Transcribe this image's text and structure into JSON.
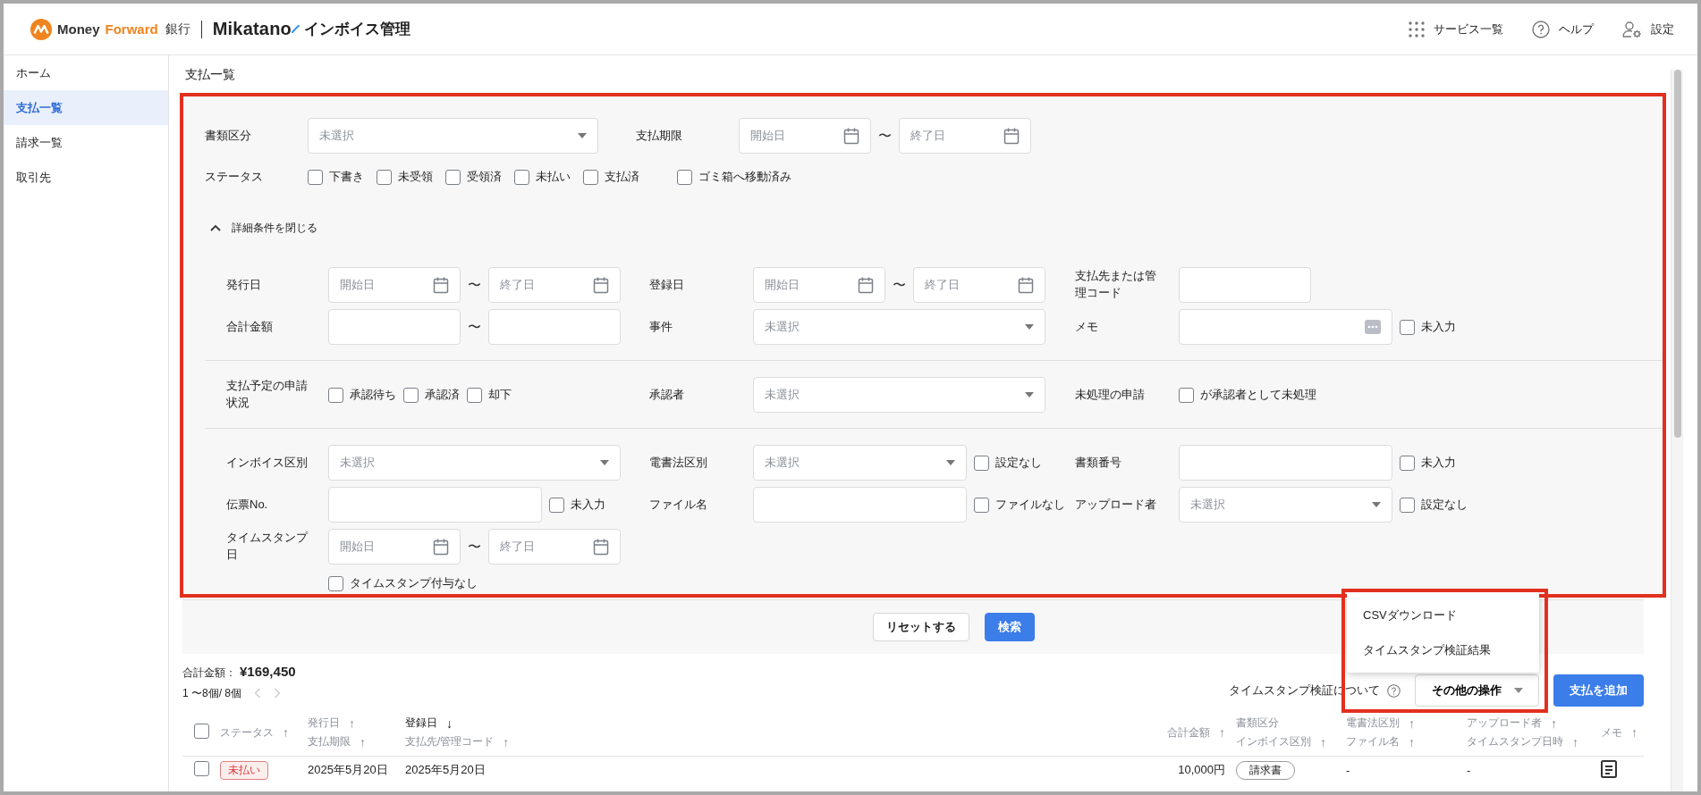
{
  "header": {
    "logo_word_1": "Money",
    "logo_word_2": "Forward",
    "logo_suffix": "銀行",
    "product_name": "Mikatano",
    "product_suffix": "インボイス管理",
    "links": [
      {
        "kind": "services",
        "label": "サービス一覧"
      },
      {
        "kind": "help",
        "label": "ヘルプ"
      },
      {
        "kind": "settings",
        "label": "設定"
      }
    ]
  },
  "sidebar": {
    "items": [
      {
        "label": "ホーム",
        "selected": false
      },
      {
        "label": "支払一覧",
        "selected": true
      },
      {
        "label": "請求一覧",
        "selected": false
      },
      {
        "label": "取引先",
        "selected": false
      }
    ]
  },
  "page_title": "支払一覧",
  "filters": {
    "basic": [
      {
        "fields": [
          {
            "label": "書類区分",
            "controls": [
              {
                "kind": "select",
                "placeholder": "未選択"
              }
            ]
          },
          {
            "label": "支払期限",
            "controls": [
              {
                "kind": "date",
                "placeholder": "開始日"
              },
              {
                "kind": "separator",
                "text": "〜"
              },
              {
                "kind": "date",
                "placeholder": "終了日"
              }
            ]
          }
        ]
      },
      {
        "fields": [
          {
            "label": "ステータス",
            "controls": [
              {
                "kind": "checkbox",
                "label": "下書き",
                "checked": false
              },
              {
                "kind": "checkbox",
                "label": "未受領",
                "checked": false
              },
              {
                "kind": "checkbox",
                "label": "受領済",
                "checked": false
              },
              {
                "kind": "checkbox",
                "label": "未払い",
                "checked": false
              },
              {
                "kind": "checkbox",
                "label": "支払済",
                "checked": false
              },
              {
                "kind": "checkbox",
                "label": "ゴミ箱へ移動済み",
                "checked": false
              }
            ]
          }
        ]
      }
    ],
    "toggle": {
      "label": "詳細条件を閉じる",
      "expanded": true
    },
    "groups": [
      [
        {
          "fields": [
            {
              "label": "発行日",
              "controls": [
                {
                  "kind": "date",
                  "placeholder": "開始日"
                },
                {
                  "kind": "separator",
                  "text": "〜"
                },
                {
                  "kind": "date",
                  "placeholder": "終了日"
                }
              ]
            },
            {
              "label": "登録日",
              "controls": [
                {
                  "kind": "date",
                  "placeholder": "開始日"
                },
                {
                  "kind": "separator",
                  "text": "〜"
                },
                {
                  "kind": "date",
                  "placeholder": "終了日"
                }
              ]
            },
            {
              "label": "支払先または管理コード",
              "controls": [
                {
                  "kind": "text"
                }
              ]
            }
          ]
        },
        {
          "fields": [
            {
              "label": "合計金額",
              "controls": [
                {
                  "kind": "text"
                },
                {
                  "kind": "separator",
                  "text": "〜"
                },
                {
                  "kind": "text"
                }
              ]
            },
            {
              "label": "事件",
              "controls": [
                {
                  "kind": "select",
                  "placeholder": "未選択"
                }
              ]
            },
            {
              "label": "メモ",
              "controls": [
                {
                  "kind": "memo"
                },
                {
                  "kind": "checkbox",
                  "label": "未入力",
                  "checked": false
                }
              ]
            }
          ]
        }
      ],
      [
        {
          "fields": [
            {
              "label": "支払予定の申請状況",
              "controls": [
                {
                  "kind": "checkbox",
                  "label": "承認待ち",
                  "checked": false
                },
                {
                  "kind": "checkbox",
                  "label": "承認済",
                  "checked": false
                },
                {
                  "kind": "checkbox",
                  "label": "却下",
                  "checked": false
                }
              ]
            },
            {
              "label": "承認者",
              "controls": [
                {
                  "kind": "select",
                  "placeholder": "未選択"
                }
              ]
            },
            {
              "label": "未処理の申請",
              "controls": [
                {
                  "kind": "checkbox",
                  "label": "が承認者として未処理",
                  "checked": false
                }
              ]
            }
          ]
        }
      ],
      [
        {
          "fields": [
            {
              "label": "インボイス区別",
              "controls": [
                {
                  "kind": "select",
                  "placeholder": "未選択"
                }
              ]
            },
            {
              "label": "電書法区別",
              "controls": [
                {
                  "kind": "select",
                  "placeholder": "未選択"
                },
                {
                  "kind": "checkbox",
                  "label": "設定なし",
                  "checked": false
                }
              ]
            },
            {
              "label": "書類番号",
              "controls": [
                {
                  "kind": "text"
                },
                {
                  "kind": "checkbox",
                  "label": "未入力",
                  "checked": false
                }
              ]
            }
          ]
        },
        {
          "fields": [
            {
              "label": "伝票No.",
              "controls": [
                {
                  "kind": "text"
                },
                {
                  "kind": "checkbox",
                  "label": "未入力",
                  "checked": false
                }
              ]
            },
            {
              "label": "ファイル名",
              "controls": [
                {
                  "kind": "text"
                },
                {
                  "kind": "checkbox",
                  "label": "ファイルなし",
                  "checked": false
                }
              ]
            },
            {
              "label": "アップロード者",
              "controls": [
                {
                  "kind": "select",
                  "placeholder": "未選択"
                },
                {
                  "kind": "checkbox",
                  "label": "設定なし",
                  "checked": false
                }
              ]
            }
          ]
        },
        {
          "fields": [
            {
              "label": "タイムスタンプ日",
              "controls": [
                {
                  "kind": "date",
                  "placeholder": "開始日"
                },
                {
                  "kind": "separator",
                  "text": "〜"
                },
                {
                  "kind": "date",
                  "placeholder": "終了日"
                }
              ]
            }
          ]
        },
        {
          "fields": [
            {
              "controls": [
                {
                  "kind": "checkbox",
                  "label": "タイムスタンプ付与なし",
                  "checked": false
                }
              ]
            }
          ]
        }
      ]
    ],
    "reset_button": "リセットする",
    "search_button": "検索"
  },
  "results": {
    "total_label": "合計金額：",
    "total_value": "¥169,450",
    "pagination": "1 〜8個/ 8個",
    "timestamp_help": "タイムスタンプ検証について",
    "other_actions": "その他の操作",
    "add_button": "支払を追加",
    "menu": {
      "items": [
        "CSVダウンロード",
        "タイムスタンプ検証結果"
      ]
    }
  },
  "table": {
    "select_all": {
      "checked": false
    },
    "columns": [
      {
        "kind": "text",
        "lines": [
          {
            "label": "ステータス",
            "arrow": "↑",
            "active": false
          }
        ]
      },
      {
        "kind": "text",
        "lines": [
          {
            "label": "発行日",
            "arrow": "↑",
            "active": false
          },
          {
            "label": "支払期限",
            "arrow": "↑",
            "active": false
          }
        ]
      },
      {
        "kind": "text",
        "lines": [
          {
            "label": "登録日",
            "arrow": "↓",
            "active": true
          },
          {
            "label": "支払先/管理コード",
            "arrow": "↑",
            "active": false
          }
        ]
      },
      {
        "kind": "number",
        "lines": [
          {
            "label": "合計金額",
            "arrow": "↑",
            "active": false
          }
        ]
      },
      {
        "kind": "text",
        "lines": [
          {
            "label": "書類区分",
            "active": false
          },
          {
            "label": "インボイス区別",
            "arrow": "↑",
            "active": false
          }
        ]
      },
      {
        "kind": "text",
        "lines": [
          {
            "label": "電書法区別",
            "arrow": "↑",
            "active": false
          },
          {
            "label": "ファイル名",
            "arrow": "↑",
            "active": false
          }
        ]
      },
      {
        "kind": "text",
        "lines": [
          {
            "label": "アップロード者",
            "arrow": "↑",
            "active": false
          },
          {
            "label": "タイムスタンプ日時",
            "arrow": "↑",
            "active": false
          }
        ]
      },
      {
        "kind": "text",
        "lines": [
          {
            "label": "メモ",
            "arrow": "↑",
            "active": false
          }
        ]
      }
    ],
    "rows": [
      {
        "selected": false,
        "cells": [
          {
            "kind": "badge",
            "text": "未払い"
          },
          {
            "kind": "text",
            "text": "2025年5月20日"
          },
          {
            "kind": "text",
            "text": "2025年5月20日"
          },
          {
            "kind": "number",
            "text": "10,000円"
          },
          {
            "kind": "tag",
            "text": "請求書"
          },
          {
            "kind": "text",
            "text": "-"
          },
          {
            "kind": "text",
            "text": "-"
          },
          {
            "kind": "memo_icon"
          }
        ]
      }
    ]
  }
}
